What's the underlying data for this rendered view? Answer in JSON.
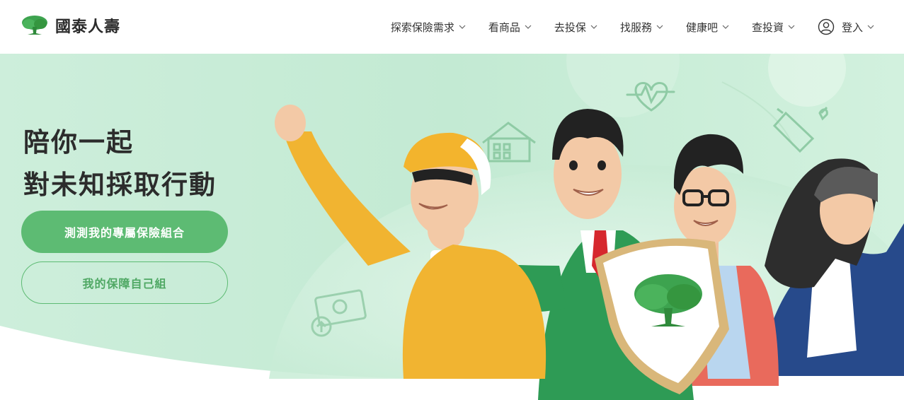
{
  "brand": {
    "name": "國泰人壽",
    "logo_icon": "tree-logo-icon",
    "logo_color": "#3da34f"
  },
  "nav": {
    "items": [
      {
        "label": "探索保險需求"
      },
      {
        "label": "看商品"
      },
      {
        "label": "去投保"
      },
      {
        "label": "找服務"
      },
      {
        "label": "健康吧"
      },
      {
        "label": "查投資"
      }
    ],
    "login_label": "登入",
    "login_icon": "user-icon",
    "dropdown_icon": "chevron-down-icon"
  },
  "hero": {
    "headline_line1": "陪你一起",
    "headline_line2": "對未知採取行動",
    "primary_button": "測測我的專屬保險組合",
    "secondary_button": "我的保障自己組",
    "illustration_icons": [
      "heartbeat-icon",
      "house-icon",
      "baby-bottle-icon",
      "money-icon",
      "shield-icon"
    ]
  },
  "colors": {
    "accent": "#5dbb73",
    "hero_bg": "#cdeed9",
    "text": "#2c2c2c"
  }
}
